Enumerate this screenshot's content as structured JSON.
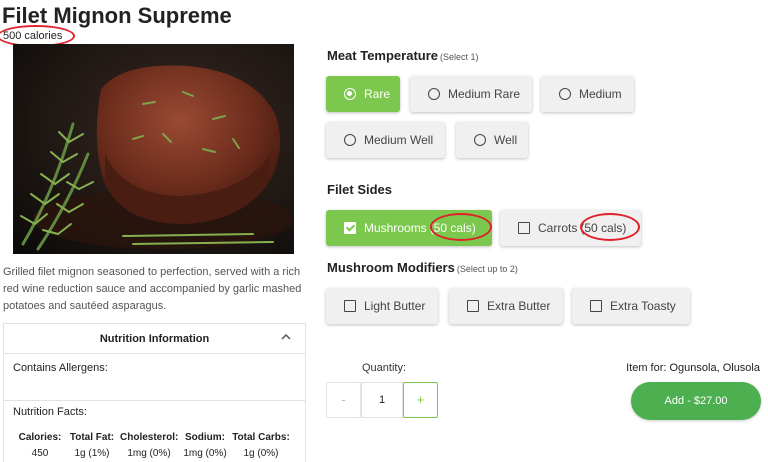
{
  "item": {
    "title": "Filet Mignon Supreme",
    "calories": "500 calories",
    "description": "Grilled filet mignon seasoned to perfection, served with a rich red wine reduction sauce and accompanied by garlic mashed potatoes and sautéed asparagus."
  },
  "nutrition": {
    "header": "Nutrition Information",
    "allergens_label": "Contains Allergens:",
    "facts_label": "Nutrition Facts:",
    "facts": [
      {
        "name": "Calories:",
        "value": "450"
      },
      {
        "name": "Total Fat:",
        "value": "1g (1%)"
      },
      {
        "name": "Cholesterol:",
        "value": "1mg (0%)"
      },
      {
        "name": "Sodium:",
        "value": "1mg (0%)"
      },
      {
        "name": "Total Carbs:",
        "value": "1g (0%)"
      }
    ]
  },
  "temperature": {
    "title": "Meat Temperature",
    "hint": "(Select 1)",
    "options": [
      {
        "label": "Rare",
        "selected": true
      },
      {
        "label": "Medium Rare",
        "selected": false
      },
      {
        "label": "Medium",
        "selected": false
      },
      {
        "label": "Medium Well",
        "selected": false
      },
      {
        "label": "Well",
        "selected": false
      }
    ]
  },
  "sides": {
    "title": "Filet Sides",
    "options": [
      {
        "label": "Mushrooms",
        "extra": "(50 cals)",
        "selected": true
      },
      {
        "label": "Carrots",
        "extra": "(50 cals)",
        "selected": false
      }
    ]
  },
  "modifiers": {
    "title": "Mushroom Modifiers",
    "hint": "(Select up to 2)",
    "options": [
      {
        "label": "Light Butter",
        "selected": false
      },
      {
        "label": "Extra Butter",
        "selected": false
      },
      {
        "label": "Extra Toasty",
        "selected": false
      }
    ]
  },
  "quantity": {
    "label": "Quantity:",
    "value": "1",
    "minus": "-",
    "plus": "+"
  },
  "order": {
    "item_for": "Item for: Ogunsola, Olusola",
    "add_label": "Add - $27.00"
  },
  "icons": {
    "nutrition_toggle": "chevron-up-icon",
    "photo": "steak-photo"
  },
  "colors": {
    "selected_green": "#7cc84e",
    "add_button_green": "#4caf50",
    "annotation_red": "#e0202a"
  }
}
